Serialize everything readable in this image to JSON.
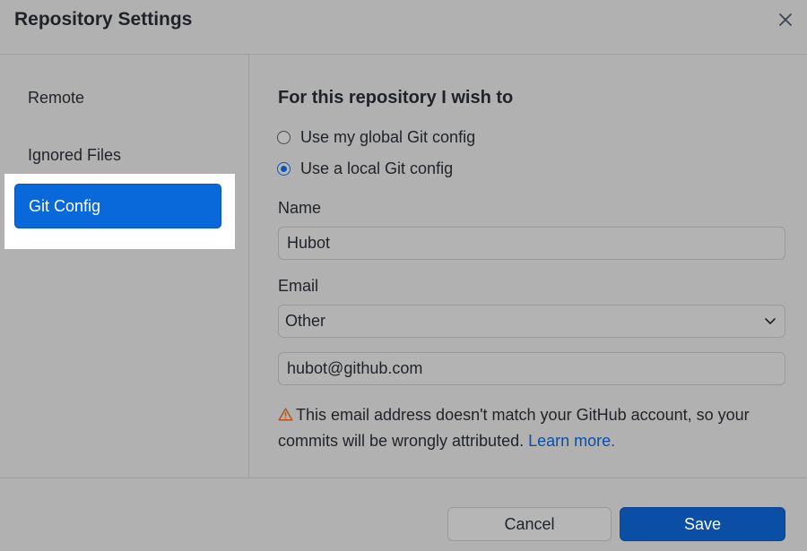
{
  "dialog": {
    "title": "Repository Settings",
    "close_icon": "close-icon"
  },
  "sidebar": {
    "items": [
      {
        "label": "Remote",
        "selected": false
      },
      {
        "label": "Ignored Files",
        "selected": false
      },
      {
        "label": "Git Config",
        "selected": true
      }
    ]
  },
  "git_config": {
    "heading": "For this repository I wish to",
    "options": [
      {
        "label": "Use my global Git config",
        "checked": false
      },
      {
        "label": "Use a local Git config",
        "checked": true
      }
    ],
    "name_label": "Name",
    "name_value": "Hubot",
    "email_label": "Email",
    "email_select_value": "Other",
    "email_value": "hubot@github.com",
    "warning_text": "This email address doesn't match your GitHub account, so your commits will be wrongly attributed.",
    "learn_more": "Learn more.",
    "warning_icon": "warning-icon"
  },
  "footer": {
    "cancel_label": "Cancel",
    "save_label": "Save"
  },
  "colors": {
    "accent": "#0969da",
    "save_button": "#0a4ea5",
    "link": "#0a4fa8",
    "warning": "#b5541c"
  }
}
